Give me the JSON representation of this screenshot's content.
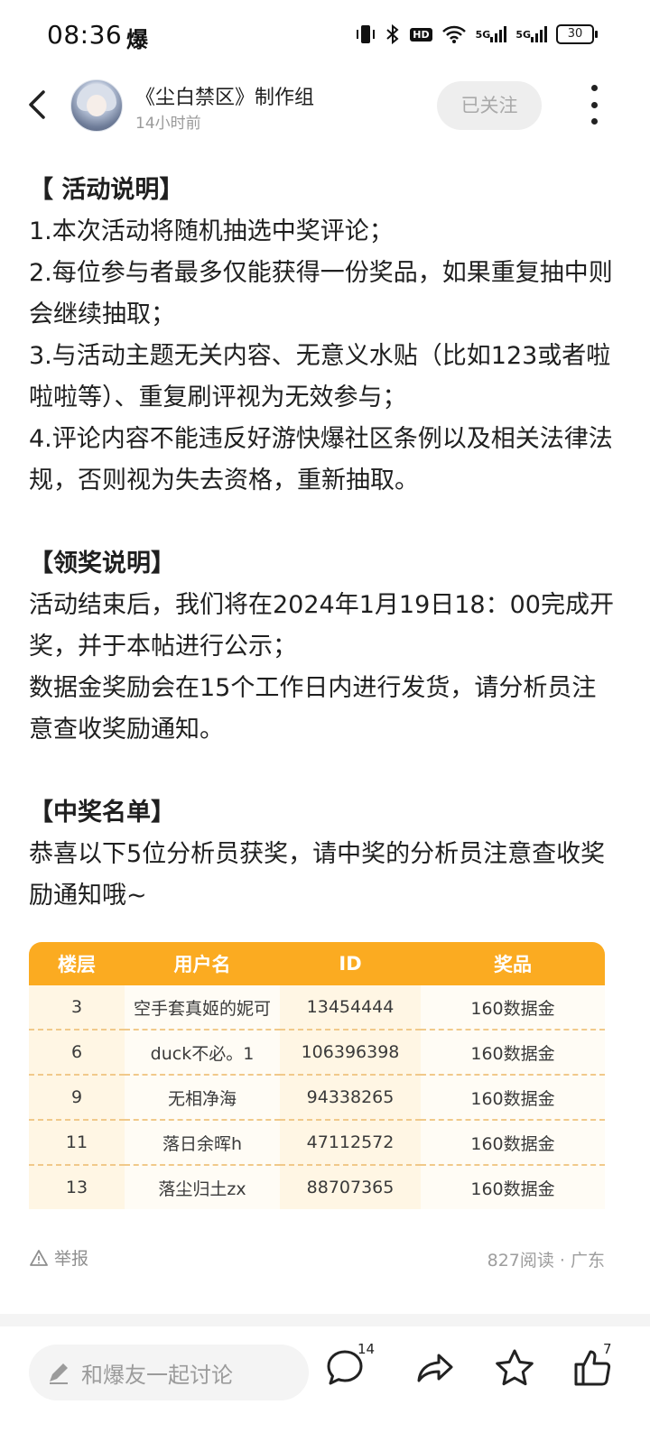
{
  "status_bar": {
    "time": "08:36",
    "time_icon": "爆",
    "battery": "30",
    "network": "5G"
  },
  "header": {
    "group_name": "《尘白禁区》制作组",
    "post_time": "14小时前",
    "follow_label": "已关注"
  },
  "article": {
    "activity_title": "【 活动说明】",
    "activity_rules": [
      "1.本次活动将随机抽选中奖评论；",
      "2.每位参与者最多仅能获得一份奖品，如果重复抽中则会继续抽取；",
      "3.与活动主题无关内容、无意义水贴（比如123或者啦啦啦等）、重复刷评视为无效参与；",
      "4.评论内容不能违反好游快爆社区条例以及相关法律法规，否则视为失去资格，重新抽取。"
    ],
    "claim_title": "【领奖说明】",
    "claim_lines": [
      "活动结束后，我们将在2024年1月19日18：00完成开奖，并于本帖进行公示；",
      "数据金奖励会在15个工作日内进行发货，请分析员注意查收奖励通知。"
    ],
    "winners_title": "【中奖名单】",
    "winners_intro": "恭喜以下5位分析员获奖，请中奖的分析员注意查收奖励通知哦~"
  },
  "winners_table": {
    "headers": [
      "楼层",
      "用户名",
      "ID",
      "奖品"
    ],
    "rows": [
      [
        "3",
        "空手套真姬的妮可",
        "13454444",
        "160数据金"
      ],
      [
        "6",
        "duck不必。1",
        "106396398",
        "160数据金"
      ],
      [
        "9",
        "无相净海",
        "94338265",
        "160数据金"
      ],
      [
        "11",
        "落日余晖h",
        "47112572",
        "160数据金"
      ],
      [
        "13",
        "落尘归土zx",
        "88707365",
        "160数据金"
      ]
    ]
  },
  "post_footer": {
    "report_label": "举报",
    "meta": "827阅读 · 广东"
  },
  "bottom_bar": {
    "comment_placeholder": "和爆友一起讨论",
    "comment_count": "14",
    "like_count": "7"
  },
  "colors": {
    "table_header": "#fbab21",
    "table_row_bg": "#fffcf5",
    "follow_btn_bg": "#eeeeee"
  },
  "icons": [
    "back-arrow-icon",
    "more-vertical-icon",
    "warning-triangle-icon",
    "pen-icon",
    "comment-bubble-icon",
    "share-icon",
    "star-icon",
    "thumbs-up-icon"
  ]
}
